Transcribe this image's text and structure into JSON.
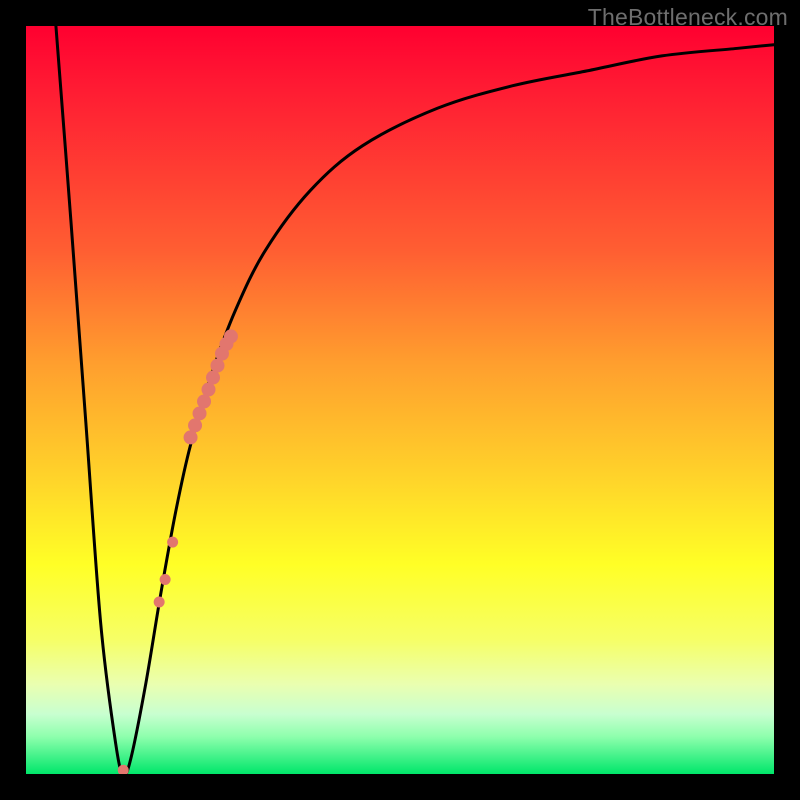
{
  "watermark": "TheBottleneck.com",
  "chart_data": {
    "type": "line",
    "title": "",
    "xlabel": "",
    "ylabel": "",
    "xlim": [
      0,
      100
    ],
    "ylim": [
      0,
      100
    ],
    "series": [
      {
        "name": "bottleneck-curve",
        "x": [
          4,
          6,
          8,
          10,
          12,
          13,
          14,
          16,
          18,
          20,
          22,
          25,
          28,
          32,
          38,
          45,
          55,
          65,
          75,
          85,
          95,
          100
        ],
        "y": [
          100,
          74,
          47,
          20,
          4,
          0,
          2,
          12,
          24,
          35,
          44,
          54,
          62,
          70,
          78,
          84,
          89,
          92,
          94,
          96,
          97,
          97.5
        ]
      }
    ],
    "markers": [
      {
        "name": "highlight-segment-thick",
        "color": "#e2766e",
        "points": [
          {
            "x": 22.0,
            "y": 45.0
          },
          {
            "x": 22.6,
            "y": 46.6
          },
          {
            "x": 23.2,
            "y": 48.2
          },
          {
            "x": 23.8,
            "y": 49.8
          },
          {
            "x": 24.4,
            "y": 51.4
          },
          {
            "x": 25.0,
            "y": 53.0
          },
          {
            "x": 25.6,
            "y": 54.6
          },
          {
            "x": 26.2,
            "y": 56.2
          },
          {
            "x": 26.8,
            "y": 57.5
          },
          {
            "x": 27.4,
            "y": 58.5
          }
        ]
      },
      {
        "name": "highlight-dots-lower",
        "color": "#e2766e",
        "points": [
          {
            "x": 17.8,
            "y": 23.0
          },
          {
            "x": 18.6,
            "y": 26.0
          },
          {
            "x": 19.6,
            "y": 31.0
          }
        ]
      },
      {
        "name": "valley-dot",
        "color": "#e2766e",
        "points": [
          {
            "x": 13.0,
            "y": 0.5
          }
        ]
      }
    ]
  }
}
